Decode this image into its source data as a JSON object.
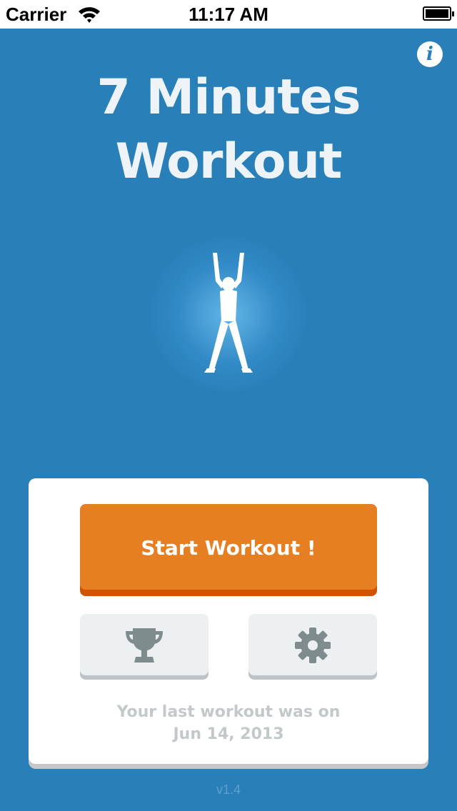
{
  "status_bar": {
    "carrier": "Carrier",
    "time": "11:17 AM",
    "icons": [
      "wifi-icon",
      "battery-icon"
    ]
  },
  "header": {
    "info_icon": "info-icon",
    "title_line1": "7 Minutes",
    "title_line2": "Workout",
    "illustration": "jumping-jack-figure"
  },
  "card": {
    "start_label": "Start Workout !",
    "trophy_icon": "trophy-icon",
    "settings_icon": "gear-icon",
    "last_workout_line1": "Your last workout was on",
    "last_workout_line2": "Jun 14, 2013"
  },
  "footer": {
    "version": "v1.4"
  },
  "colors": {
    "background": "#2980b9",
    "start_button": "#e67e22",
    "start_button_shadow": "#d35400",
    "secondary_button": "#ecf0f1",
    "muted_text": "#c3c8cb"
  }
}
